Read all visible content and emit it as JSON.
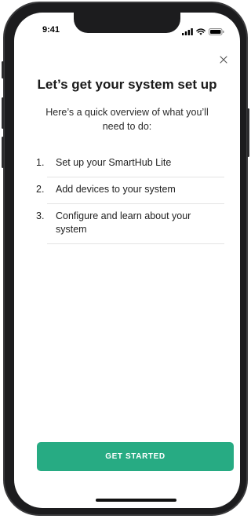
{
  "status_bar": {
    "time": "9:41",
    "icons": [
      "signal-icon",
      "wifi-icon",
      "battery-icon"
    ]
  },
  "modal": {
    "close_icon": "close-icon",
    "title": "Let’s get your system set up",
    "subtitle": "Here’s a quick overview of what you’ll need to do:",
    "steps": [
      {
        "number": "1.",
        "label": "Set up your SmartHub Lite"
      },
      {
        "number": "2.",
        "label": "Add devices to your system"
      },
      {
        "number": "3.",
        "label": "Configure and learn about your system"
      }
    ],
    "cta_label": "GET STARTED"
  },
  "colors": {
    "accent": "#27ab83",
    "text": "#1a1a1a",
    "divider": "#e3e3e3",
    "frame": "#1c1c1e"
  }
}
